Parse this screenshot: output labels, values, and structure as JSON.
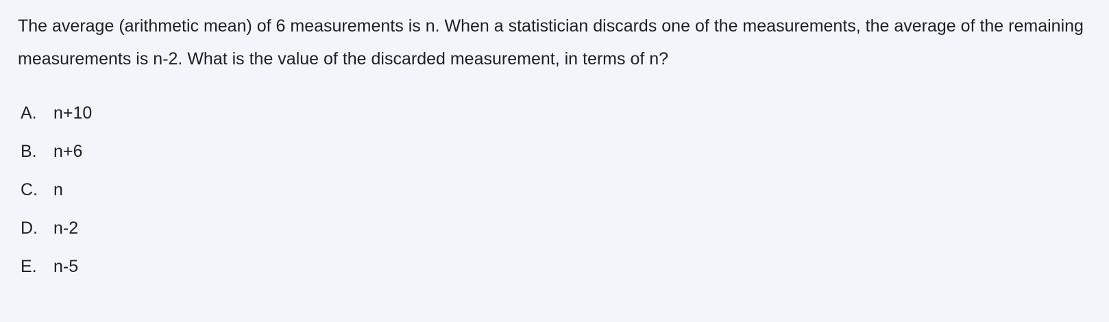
{
  "question": {
    "text": "The average (arithmetic mean) of 6 measurements is n. When a statistician discards one of the measurements, the average of the remaining measurements is n-2. What is the value of the discarded measurement, in terms of n?"
  },
  "choices": [
    {
      "letter": "A.",
      "text": "n+10"
    },
    {
      "letter": "B.",
      "text": "n+6"
    },
    {
      "letter": "C.",
      "text": "n"
    },
    {
      "letter": "D.",
      "text": "n-2"
    },
    {
      "letter": "E.",
      "text": "n-5"
    }
  ],
  "colors": {
    "background": "#f2f6fb",
    "text": "#1f1f1f"
  }
}
